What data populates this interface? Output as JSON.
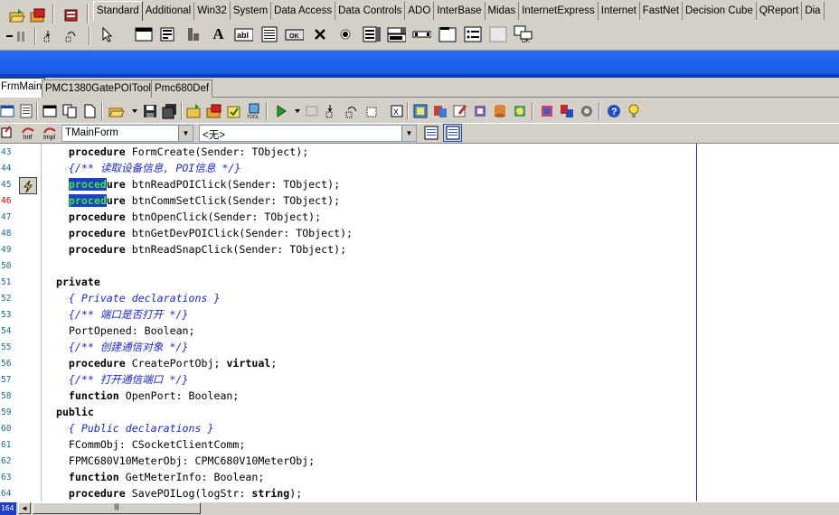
{
  "palette": {
    "tabs": [
      "Standard",
      "Additional",
      "Win32",
      "System",
      "Data Access",
      "Data Controls",
      "ADO",
      "InterBase",
      "Midas",
      "InternetExpress",
      "Internet",
      "FastNet",
      "Decision Cube",
      "QReport",
      "Dia"
    ],
    "active_tab": "Standard"
  },
  "file_tabs": [
    "FrmMain",
    "PMC1380GatePOITool",
    "Pmc680Def"
  ],
  "combo": {
    "class_value": "TMainForm",
    "method_value": "<无>"
  },
  "gutter_labels": {
    "intf": "Intf",
    "impl": "Impl"
  },
  "lines": [
    {
      "num": "43",
      "code": [
        {
          "t": "    "
        },
        {
          "t": "procedure",
          "k": "kw"
        },
        {
          "t": " FormCreate(Sender: TObject);"
        }
      ]
    },
    {
      "num": "44",
      "code": [
        {
          "t": "    "
        },
        {
          "t": "{/** 读取设备信息, POI信息 */}",
          "k": "cm"
        }
      ]
    },
    {
      "num": "45",
      "code": [
        {
          "t": "    "
        },
        {
          "t": "proced",
          "k": "sel"
        },
        {
          "t": "ure",
          "k": "kw"
        },
        {
          "t": " btnReadPOIClick(Sender: TObject);"
        }
      ]
    },
    {
      "num": "46",
      "red": true,
      "code": [
        {
          "t": "    "
        },
        {
          "t": "proced",
          "k": "sel"
        },
        {
          "t": "ure",
          "k": "kw"
        },
        {
          "t": " btnCommSetClick(Sender: TObject);"
        }
      ]
    },
    {
      "num": "47",
      "code": [
        {
          "t": "    "
        },
        {
          "t": "procedure",
          "k": "kw"
        },
        {
          "t": " btnOpenClick(Sender: TObject);"
        }
      ]
    },
    {
      "num": "48",
      "code": [
        {
          "t": "    "
        },
        {
          "t": "procedure",
          "k": "kw"
        },
        {
          "t": " btnGetDevPOIClick(Sender: TObject);"
        }
      ]
    },
    {
      "num": "49",
      "code": [
        {
          "t": "    "
        },
        {
          "t": "procedure",
          "k": "kw"
        },
        {
          "t": " btnReadSnapClick(Sender: TObject);"
        }
      ]
    },
    {
      "num": "50",
      "code": []
    },
    {
      "num": "51",
      "code": [
        {
          "t": "  "
        },
        {
          "t": "private",
          "k": "kw"
        }
      ]
    },
    {
      "num": "52",
      "code": [
        {
          "t": "    "
        },
        {
          "t": "{ Private declarations }",
          "k": "cm"
        }
      ]
    },
    {
      "num": "53",
      "code": [
        {
          "t": "    "
        },
        {
          "t": "{/** 端口是否打开 */}",
          "k": "cm"
        }
      ]
    },
    {
      "num": "54",
      "code": [
        {
          "t": "    PortOpened: Boolean;"
        }
      ]
    },
    {
      "num": "55",
      "code": [
        {
          "t": "    "
        },
        {
          "t": "{/** 创建通信对象 */}",
          "k": "cm"
        }
      ]
    },
    {
      "num": "56",
      "code": [
        {
          "t": "    "
        },
        {
          "t": "procedure",
          "k": "kw"
        },
        {
          "t": " CreatePortObj; "
        },
        {
          "t": "virtual",
          "k": "kw"
        },
        {
          "t": ";"
        }
      ]
    },
    {
      "num": "57",
      "code": [
        {
          "t": "    "
        },
        {
          "t": "{/** 打开通信端口 */}",
          "k": "cm"
        }
      ]
    },
    {
      "num": "58",
      "code": [
        {
          "t": "    "
        },
        {
          "t": "function",
          "k": "kw"
        },
        {
          "t": " OpenPort: Boolean;"
        }
      ]
    },
    {
      "num": "59",
      "code": [
        {
          "t": "  "
        },
        {
          "t": "public",
          "k": "kw"
        }
      ]
    },
    {
      "num": "60",
      "code": [
        {
          "t": "    "
        },
        {
          "t": "{ Public declarations }",
          "k": "cm"
        }
      ]
    },
    {
      "num": "61",
      "code": [
        {
          "t": "    FCommObj: CSocketClientComm;"
        }
      ]
    },
    {
      "num": "62",
      "code": [
        {
          "t": "    FPMC680V10MeterObj: CPMC680V10MeterObj;"
        }
      ]
    },
    {
      "num": "63",
      "code": [
        {
          "t": "    "
        },
        {
          "t": "function",
          "k": "kw"
        },
        {
          "t": " GetMeterInfo: Boolean;"
        }
      ]
    },
    {
      "num": "64",
      "code": [
        {
          "t": "    "
        },
        {
          "t": "procedure",
          "k": "kw"
        },
        {
          "t": " SavePOILog(logStr: "
        },
        {
          "t": "string",
          "k": "kw"
        },
        {
          "t": ");"
        }
      ]
    }
  ],
  "status_line": "164"
}
